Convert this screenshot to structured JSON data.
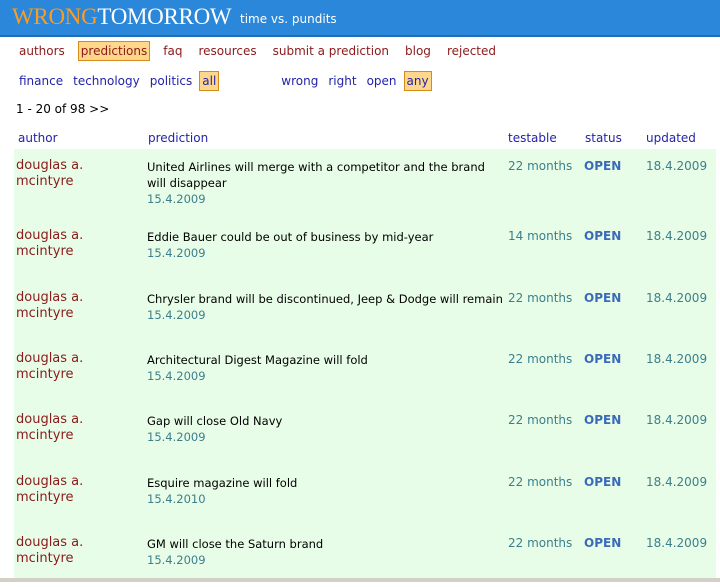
{
  "header": {
    "logo_wrong": "WRONG",
    "logo_tomorrow": "TOMORROW",
    "tagline": "time vs. pundits"
  },
  "nav": {
    "items": [
      "authors",
      "predictions",
      "faq",
      "resources",
      "submit a prediction",
      "blog",
      "rejected"
    ],
    "selected": "predictions"
  },
  "filters": {
    "categories": [
      "finance",
      "technology",
      "politics",
      "all"
    ],
    "selected_category": "all",
    "outcomes": [
      "wrong",
      "right",
      "open",
      "any"
    ],
    "selected_outcome": "any"
  },
  "pager": "1 - 20 of 98 >>",
  "columns": {
    "author": "author",
    "prediction": "prediction",
    "testable": "testable",
    "status": "status",
    "updated": "updated"
  },
  "rows": [
    {
      "author": "douglas a. mcintyre",
      "prediction": "United Airlines will merge with a competitor and the brand will disappear",
      "date": "15.4.2009",
      "testable": "22 months",
      "status": "OPEN",
      "updated": "18.4.2009"
    },
    {
      "author": "douglas a. mcintyre",
      "prediction": "Eddie Bauer could be out of business by mid-year",
      "date": "15.4.2009",
      "testable": "14 months",
      "status": "OPEN",
      "updated": "18.4.2009"
    },
    {
      "author": "douglas a. mcintyre",
      "prediction": "Chrysler brand will be discontinued, Jeep & Dodge will remain",
      "date": "15.4.2009",
      "testable": "22 months",
      "status": "OPEN",
      "updated": "18.4.2009"
    },
    {
      "author": "douglas a. mcintyre",
      "prediction": "Architectural Digest Magazine will fold",
      "date": "15.4.2009",
      "testable": "22 months",
      "status": "OPEN",
      "updated": "18.4.2009"
    },
    {
      "author": "douglas a. mcintyre",
      "prediction": "Gap will close Old Navy",
      "date": "15.4.2009",
      "testable": "22 months",
      "status": "OPEN",
      "updated": "18.4.2009"
    },
    {
      "author": "douglas a. mcintyre",
      "prediction": "Esquire magazine will fold",
      "date": "15.4.2010",
      "testable": "22 months",
      "status": "OPEN",
      "updated": "18.4.2009"
    },
    {
      "author": "douglas a. mcintyre",
      "prediction": "GM will close the Saturn brand",
      "date": "15.4.2009",
      "testable": "22 months",
      "status": "OPEN",
      "updated": "18.4.2009"
    }
  ]
}
